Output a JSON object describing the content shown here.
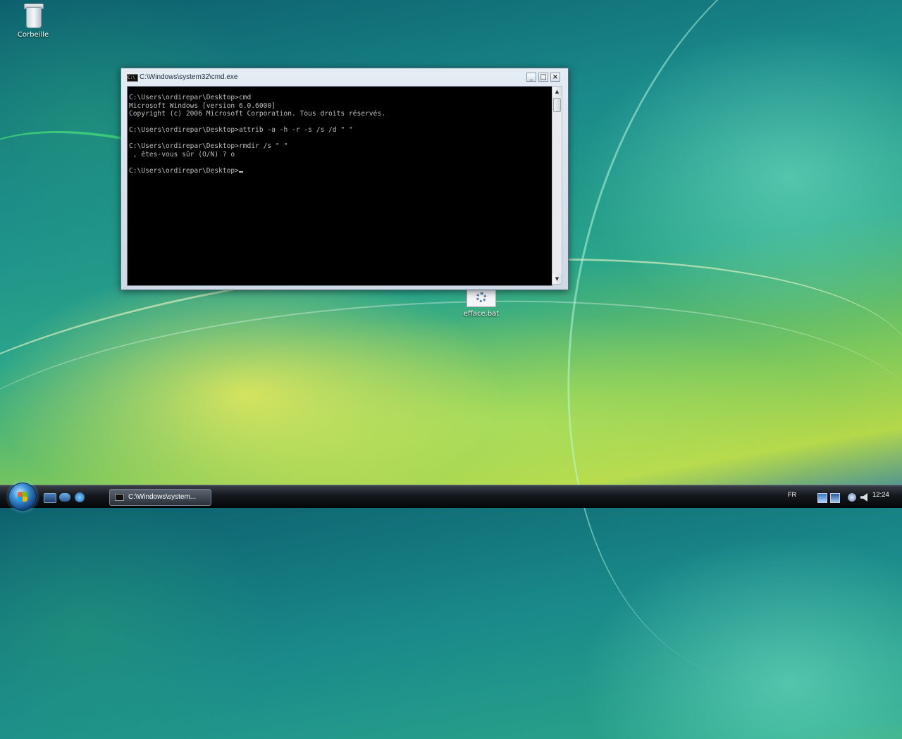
{
  "desktop": {
    "icons": [
      {
        "label": "Corbeille",
        "icon": "recycle-bin-icon"
      },
      {
        "label": "efface.bat",
        "icon": "batch-file-icon"
      }
    ]
  },
  "window": {
    "title": "C:\\Windows\\system32\\cmd.exe",
    "controls": {
      "minimize": "_",
      "maximize": "□",
      "close": "×"
    },
    "console_lines": [
      "C:\\Users\\ordirepar\\Desktop>cmd",
      "Microsoft Windows [version 6.0.6000]",
      "Copyright (c) 2006 Microsoft Corporation. Tous droits réservés.",
      "",
      "C:\\Users\\ordirepar\\Desktop>attrib -a -h -r -s /s /d \" \"",
      "",
      "C:\\Users\\ordirepar\\Desktop>rmdir /s \" \"",
      " , êtes-vous sûr (O/N) ? o",
      "",
      "C:\\Users\\ordirepar\\Desktop>"
    ],
    "scroll_up": "▲",
    "scroll_down": "▼"
  },
  "taskbar": {
    "task_label": "C:\\Windows\\system...",
    "language": "FR",
    "clock": "12:24"
  }
}
